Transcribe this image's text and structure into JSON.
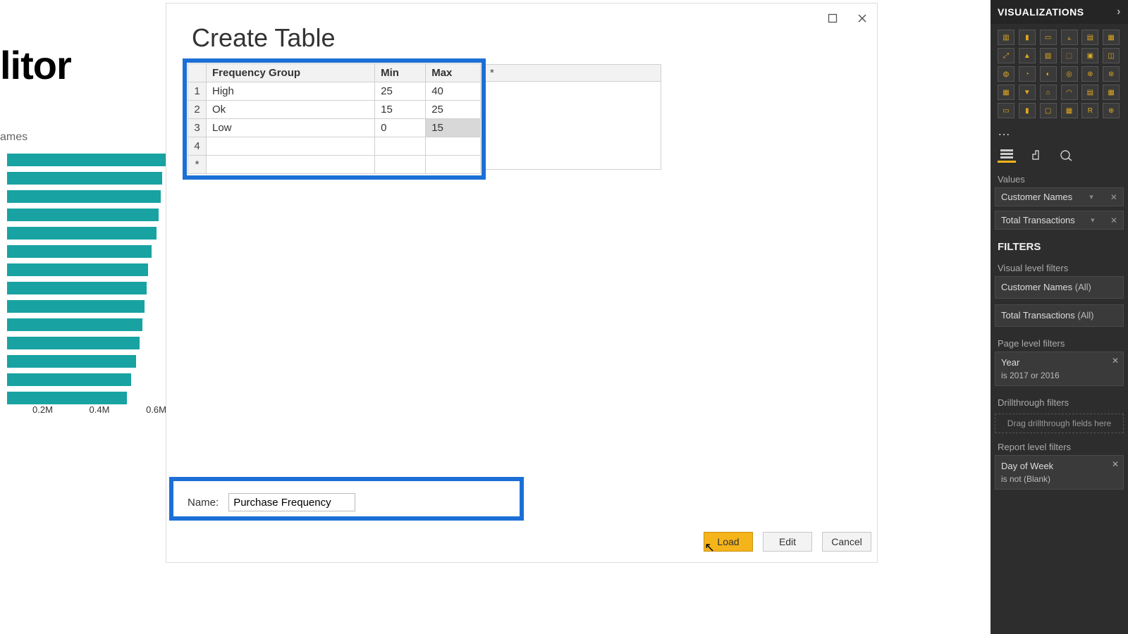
{
  "bg": {
    "title": "litor",
    "label": "ames",
    "ticks": [
      "0.2M",
      "0.4M",
      "0.6M"
    ],
    "bars": [
      225,
      220,
      218,
      215,
      212,
      205,
      200,
      198,
      195,
      192,
      188,
      183,
      176,
      170
    ]
  },
  "dialog": {
    "title": "Create Table",
    "maximize_title": "Maximize",
    "close_title": "Close",
    "new_col_marker": "*",
    "table": {
      "headers": [
        "Frequency Group",
        "Min",
        "Max"
      ],
      "rows": [
        {
          "n": "1",
          "cells": [
            "High",
            "25",
            "40"
          ]
        },
        {
          "n": "2",
          "cells": [
            "Ok",
            "15",
            "25"
          ]
        },
        {
          "n": "3",
          "cells": [
            "Low",
            "0",
            "15"
          ],
          "selected_col": 2
        }
      ],
      "blank_row_n": "4",
      "new_row_marker": "*"
    },
    "name_label": "Name:",
    "name_value": "Purchase Frequency",
    "buttons": {
      "load": "Load",
      "edit": "Edit",
      "cancel": "Cancel"
    }
  },
  "side": {
    "title": "VISUALIZATIONS",
    "tabs": {
      "fields": "Fields",
      "format": "Format",
      "analytics": "Analytics"
    },
    "values_label": "Values",
    "value_wells": [
      "Customer Names",
      "Total Transactions"
    ],
    "filters_title": "FILTERS",
    "visual_filters_label": "Visual level filters",
    "visual_filters": [
      {
        "name": "Customer Names",
        "scope": "(All)"
      },
      {
        "name": "Total Transactions",
        "scope": "(All)"
      }
    ],
    "page_filters_label": "Page level filters",
    "page_filter": {
      "name": "Year",
      "desc": "is 2017 or 2016"
    },
    "drill_label": "Drillthrough filters",
    "drill_placeholder": "Drag drillthrough fields here",
    "report_filters_label": "Report level filters",
    "report_filter": {
      "name": "Day of Week",
      "desc": "is not (Blank)"
    }
  },
  "chart_data": {
    "type": "bar",
    "orientation": "horizontal",
    "categories_visible": false,
    "values_approx": [
      0.6,
      0.59,
      0.58,
      0.57,
      0.56,
      0.55,
      0.53,
      0.53,
      0.52,
      0.51,
      0.5,
      0.49,
      0.47,
      0.45
    ],
    "xlabel": "",
    "ylabel": "",
    "xlim": [
      0,
      0.7
    ],
    "x_ticks": [
      "0.2M",
      "0.4M",
      "0.6M"
    ],
    "note": "leftmost portion of a larger horizontal bar chart; category labels cropped"
  }
}
